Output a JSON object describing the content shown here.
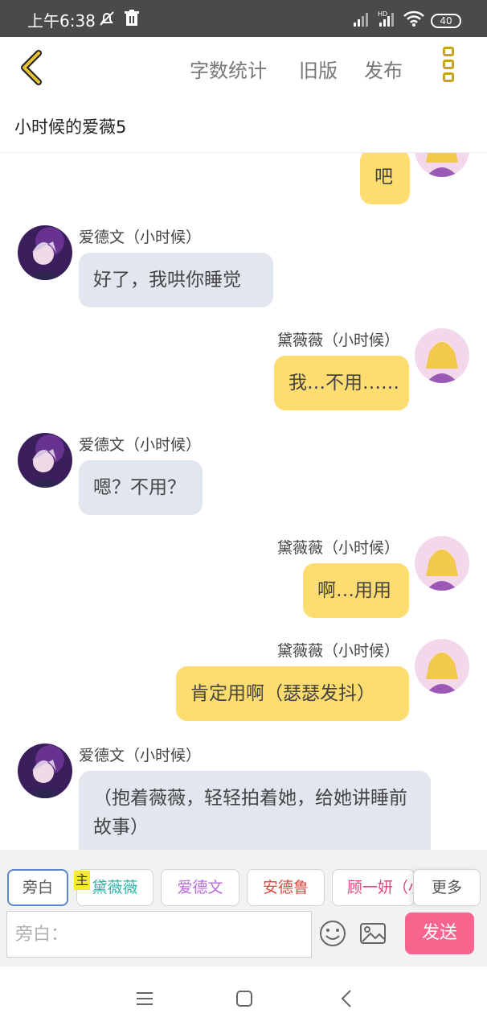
{
  "status_bar": {
    "time": "上午6:38",
    "battery": "40"
  },
  "app_bar": {
    "actions": [
      "字数统计",
      "旧版",
      "发布"
    ]
  },
  "chat_title": "小时候的爱薇5",
  "messages": [
    {
      "side": "right",
      "sender": "",
      "text": "吧"
    },
    {
      "side": "left",
      "sender": "爱德文（小时候）",
      "text": "好了，我哄你睡觉"
    },
    {
      "side": "right",
      "sender": "黛薇薇（小时候）",
      "text": "我…不用……"
    },
    {
      "side": "left",
      "sender": "爱德文（小时候）",
      "text": "嗯？不用？"
    },
    {
      "side": "right",
      "sender": "黛薇薇（小时候）",
      "text": "啊…用用"
    },
    {
      "side": "right",
      "sender": "黛薇薇（小时候）",
      "text": "肯定用啊（瑟瑟发抖）"
    },
    {
      "side": "left",
      "sender": "爱德文（小时候）",
      "text": "（抱着薇薇，轻轻拍着她，给她讲睡前故事）"
    }
  ],
  "characters": [
    {
      "label": "旁白",
      "color": "#666666"
    },
    {
      "label": "黛薇薇",
      "color": "#2bb5a9"
    },
    {
      "label": "爱德文",
      "color": "#b86ad6"
    },
    {
      "label": "安德鲁",
      "color": "#d9473f"
    },
    {
      "label": "顾一妍（小",
      "color": "#e0457a"
    }
  ],
  "main_tag": "主",
  "more_label": "更多",
  "input": {
    "placeholder": "旁白：",
    "value": ""
  },
  "send_label": "发送",
  "colors": {
    "left_bubble": "#e2e7ef",
    "right_bubble": "#fddc70",
    "send": "#f7658f",
    "accent": "#c6a31a"
  }
}
